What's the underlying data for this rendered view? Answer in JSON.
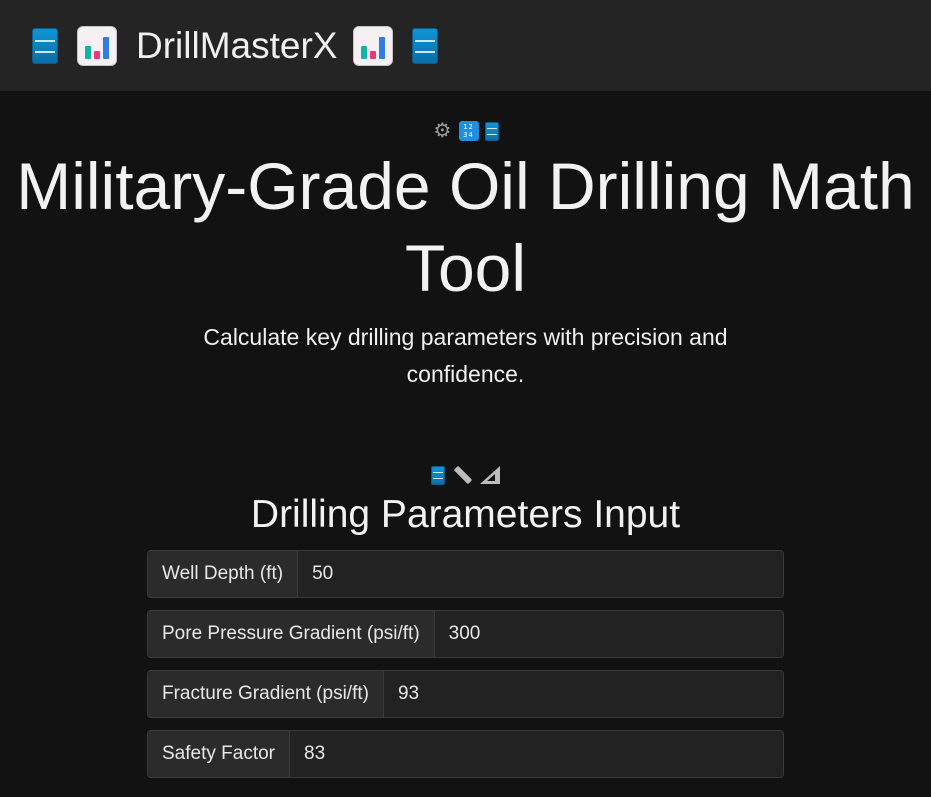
{
  "navbar": {
    "brand": "DrillMasterX",
    "icons": [
      "barrel-icon",
      "bar-chart-icon",
      "bar-chart-icon",
      "barrel-icon"
    ]
  },
  "hero": {
    "icons": [
      "gear-icon",
      "numbers-icon",
      "barrel-icon"
    ],
    "title": "Military-Grade Oil Drilling Math Tool",
    "subtitle": "Calculate key drilling parameters with precision and confidence."
  },
  "section": {
    "icons": [
      "barrel-icon",
      "ruler-icon",
      "triangle-ruler-icon"
    ],
    "title": "Drilling Parameters Input"
  },
  "form": {
    "fields": [
      {
        "label": "Well Depth (ft)",
        "value": "50"
      },
      {
        "label": "Pore Pressure Gradient (psi/ft)",
        "value": "300"
      },
      {
        "label": "Fracture Gradient (psi/ft)",
        "value": "93"
      },
      {
        "label": "Safety Factor",
        "value": "83"
      }
    ]
  },
  "colors": {
    "background": "#121212",
    "navbar": "#242424",
    "accent_blue": "#0e95d6"
  }
}
